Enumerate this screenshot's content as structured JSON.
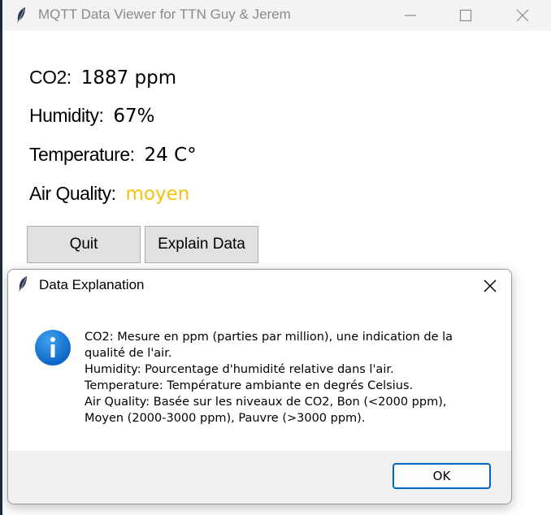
{
  "main_window": {
    "title": "MQTT Data Viewer for TTN Guy & Jerem",
    "rows": [
      {
        "label": "CO2:",
        "value": "1887 ppm"
      },
      {
        "label": "Humidity:",
        "value": "67%"
      },
      {
        "label": "Temperature:",
        "value": "24 C°"
      },
      {
        "label": "Air Quality:",
        "value": "moyen"
      }
    ],
    "air_quality_color": "#f1c40f",
    "quit_label": "Quit",
    "explain_label": "Explain Data"
  },
  "dialog": {
    "title": "Data Explanation",
    "icon": "info-icon",
    "lines": [
      "CO2: Mesure en ppm (parties par million), une indication de la",
      "qualité de l'air.",
      "Humidity: Pourcentage d'humidité relative dans l'air.",
      "Temperature: Température ambiante en degrés Celsius.",
      "Air Quality: Basée sur les niveaux de CO2, Bon (<2000 ppm),",
      "Moyen (2000-3000 ppm), Pauvre (>3000 ppm)."
    ],
    "ok_label": "OK",
    "accent": "#0067c0"
  }
}
